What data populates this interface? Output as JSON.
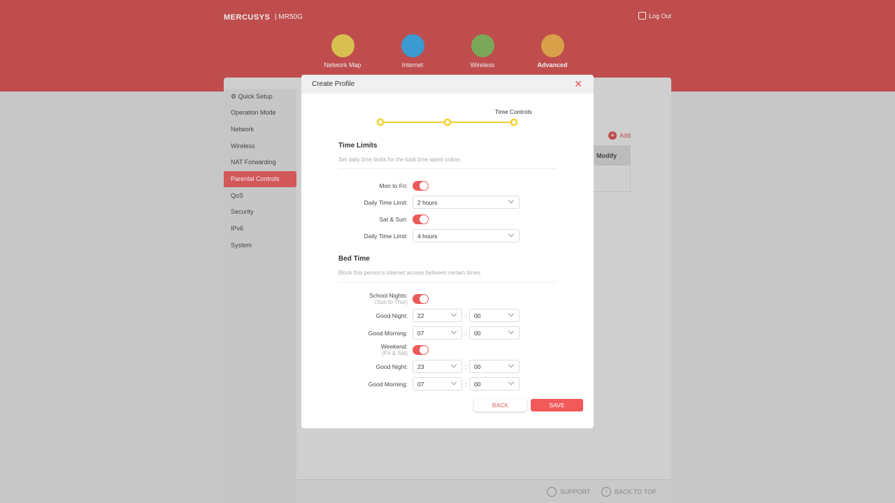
{
  "header": {
    "brand": "MERCUSYS",
    "model": "MR50G",
    "logout": "Log Out",
    "nav": [
      {
        "label": "Network Map",
        "icon": "network-map-icon",
        "color": "#d8c050"
      },
      {
        "label": "Internet",
        "icon": "globe-icon",
        "color": "#3b9ad0"
      },
      {
        "label": "Wireless",
        "icon": "wifi-icon",
        "color": "#7aa858"
      },
      {
        "label": "Advanced",
        "icon": "gear-icon",
        "color": "#d8a048",
        "active": true
      }
    ]
  },
  "sidebar": {
    "items": [
      {
        "label": "Quick Setup",
        "icon": "gear-icon"
      },
      {
        "label": "Operation Mode"
      },
      {
        "label": "Network"
      },
      {
        "label": "Wireless"
      },
      {
        "label": "NAT Forwarding"
      },
      {
        "label": "Parental Controls",
        "active": true
      },
      {
        "label": "QoS"
      },
      {
        "label": "Security"
      },
      {
        "label": "IPv6"
      },
      {
        "label": "System"
      }
    ]
  },
  "content": {
    "add": "Add",
    "table_header": "Modify"
  },
  "footer": {
    "support": "SUPPORT",
    "back_to_top": "BACK TO TOP"
  },
  "modal": {
    "title": "Create Profile",
    "step_label": "Time Controls",
    "time_limits": {
      "title": "Time Limits",
      "desc": "Set daily time limits for the total time spent online.",
      "weekday_label": "Mon to Fri:",
      "weekday_on": true,
      "weekday_limit_label": "Daily Time Limit:",
      "weekday_limit": "2 hours",
      "weekend_label": "Sat & Sun:",
      "weekend_on": true,
      "weekend_limit_label": "Daily Time Limit:",
      "weekend_limit": "4 hours"
    },
    "bed_time": {
      "title": "Bed Time",
      "desc": "Block this person's internet access between certain times.",
      "school": {
        "label": "School Nights:",
        "sub": "(Sun to Thur)",
        "on": true,
        "night_label": "Good Night:",
        "night_h": "22",
        "night_m": "00",
        "morning_label": "Good Morning:",
        "morning_h": "07",
        "morning_m": "00"
      },
      "weekend": {
        "label": "Weekend:",
        "sub": "(Fri & Sat)",
        "on": true,
        "night_label": "Good Night:",
        "night_h": "23",
        "night_m": "00",
        "morning_label": "Good Morning:",
        "morning_h": "07",
        "morning_m": "00"
      }
    },
    "back": "BACK",
    "save": "SAVE"
  },
  "colors": {
    "header": "#c04d4d",
    "accent": "#f05a5a",
    "step": "#f2cc10"
  }
}
